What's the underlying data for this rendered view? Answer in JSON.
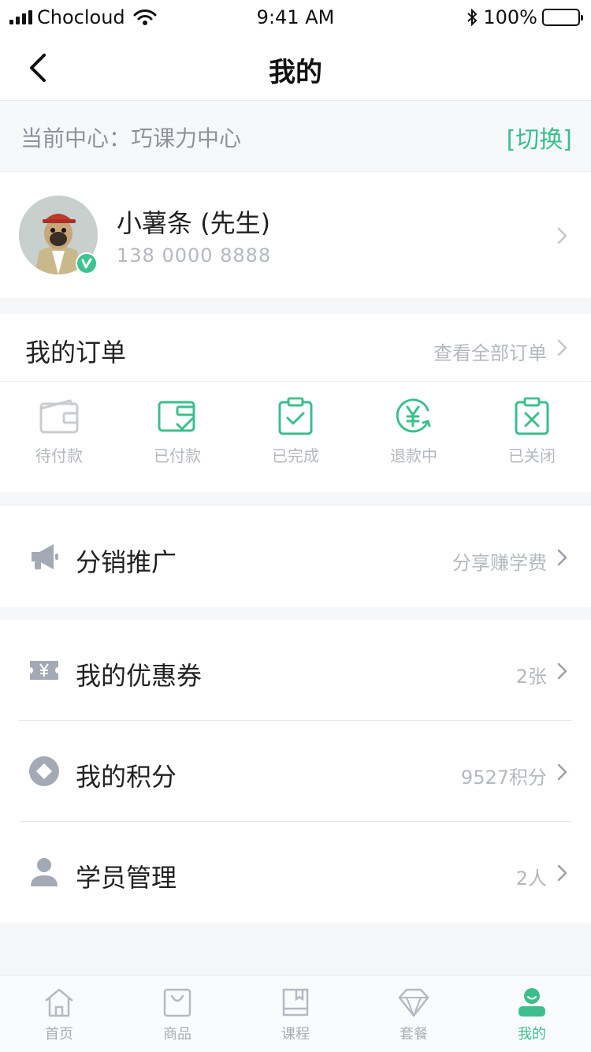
{
  "status_bar": {
    "carrier": "Chocloud",
    "time": "9:41 AM",
    "battery": "100%",
    "battery_level": 1.0
  },
  "nav": {
    "title": "我的"
  },
  "center": {
    "label": "当前中心：巧课力中心",
    "switch_label": "[切换]"
  },
  "profile": {
    "name": "小薯条 (先生)",
    "phone": "138 0000 8888"
  },
  "orders": {
    "title": "我的订单",
    "view_all": "查看全部订单",
    "items": [
      {
        "label": "待付款",
        "icon": "wallet-icon"
      },
      {
        "label": "已付款",
        "icon": "paid-wallet-icon"
      },
      {
        "label": "已完成",
        "icon": "clipboard-check-icon"
      },
      {
        "label": "退款中",
        "icon": "yen-refund-icon"
      },
      {
        "label": "已关闭",
        "icon": "clipboard-x-icon"
      }
    ]
  },
  "menu": {
    "promotion": {
      "label": "分销推广",
      "value": "分享赚学费",
      "icon": "megaphone-icon"
    },
    "coupons": {
      "label": "我的优惠券",
      "value": "2张",
      "icon": "ticket-icon"
    },
    "points": {
      "label": "我的积分",
      "value": "9527积分",
      "icon": "diamond-coin-icon"
    },
    "students": {
      "label": "学员管理",
      "value": "2人",
      "icon": "user-icon"
    }
  },
  "tabs": [
    {
      "label": "首页",
      "icon": "home-icon"
    },
    {
      "label": "商品",
      "icon": "shopping-bag-icon"
    },
    {
      "label": "课程",
      "icon": "book-icon"
    },
    {
      "label": "套餐",
      "icon": "diamond-icon"
    },
    {
      "label": "我的",
      "icon": "profile-icon",
      "active": true
    }
  ],
  "colors": {
    "accent": "#3cbf8c",
    "muted_text": "#b4b9bf",
    "icon_gray": "#a3aab6"
  }
}
